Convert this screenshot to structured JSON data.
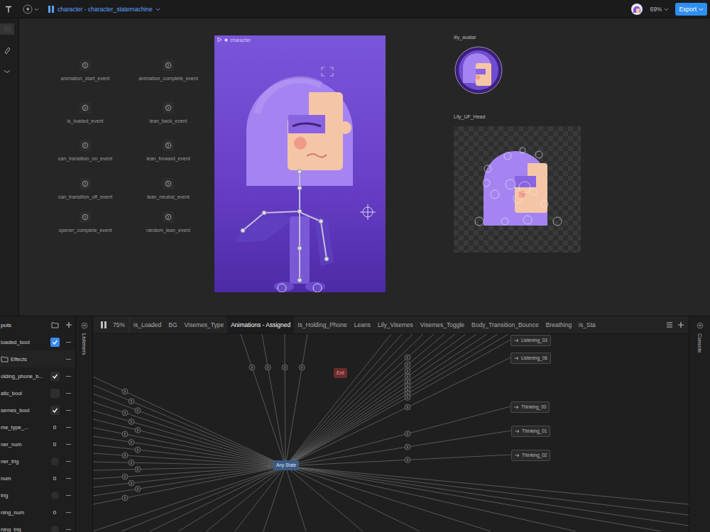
{
  "toolbar": {
    "title": "character - character_statemachine",
    "zoom": "69%",
    "export": "Export"
  },
  "artboards": {
    "main": "character",
    "avatar": "lily_avatar",
    "head": "Lily_UF_Head"
  },
  "events": [
    "animation_start_event",
    "animation_complete_event",
    "is_loaded_event",
    "lean_back_event",
    "can_transition_on_event",
    "lean_forward_event",
    "can_transition_off_event",
    "lean_neutral_event",
    "opener_complete_event",
    "random_lean_event"
  ],
  "inputs": {
    "title": "puts",
    "rows": [
      {
        "kind": "bool",
        "label": "loaded_bool",
        "checked": true,
        "highlighted": true
      },
      {
        "kind": "group",
        "label": "Effects"
      },
      {
        "kind": "bool",
        "label": "olding_phone_b...",
        "checked": true,
        "highlighted": false
      },
      {
        "kind": "bool",
        "label": "atic_bool",
        "checked": false,
        "highlighted": false
      },
      {
        "kind": "bool",
        "label": "semes_bool",
        "checked": true,
        "highlighted": false
      },
      {
        "kind": "number",
        "label": "me_type_...",
        "value": "0"
      },
      {
        "kind": "number",
        "label": "ner_num",
        "value": "0"
      },
      {
        "kind": "trigger",
        "label": "ner_trig"
      },
      {
        "kind": "number",
        "label": "num",
        "value": "0"
      },
      {
        "kind": "trigger",
        "label": "trig"
      },
      {
        "kind": "number",
        "label": "ning_num",
        "value": "0"
      },
      {
        "kind": "trigger",
        "label": "ning_trig"
      }
    ]
  },
  "side_strips": {
    "listeners": "Listeners",
    "console": "Console"
  },
  "graph": {
    "zoom": "75%",
    "tabs": [
      {
        "label": "is_Loaded",
        "selected": false
      },
      {
        "label": "BG",
        "selected": false
      },
      {
        "label": "Visemes_Type",
        "selected": false
      },
      {
        "label": "Animations - Assigned",
        "selected": true
      },
      {
        "label": "Is_Holding_Phone",
        "selected": false
      },
      {
        "label": "Leans",
        "selected": false
      },
      {
        "label": "Lily_Visemes",
        "selected": false
      },
      {
        "label": "Visemes_Toggle",
        "selected": false
      },
      {
        "label": "Body_Transition_Bounce",
        "selected": false
      },
      {
        "label": "Breathing",
        "selected": false
      },
      {
        "label": "is_Sta",
        "selected": false
      }
    ],
    "any_state": "Any State",
    "exit": "Exit",
    "states": [
      "Listening_03",
      "Listening_06",
      "Thinking_00",
      "Thinking_01",
      "Thinking_02"
    ]
  }
}
